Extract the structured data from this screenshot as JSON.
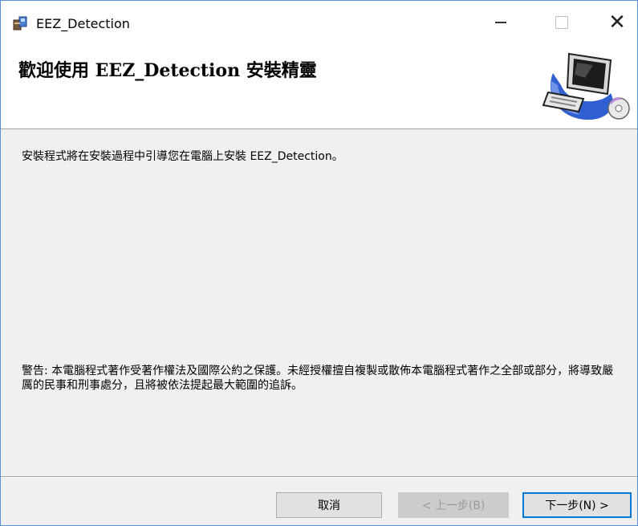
{
  "window": {
    "title": "EEZ_Detection",
    "controls": {
      "minimize": "minimize",
      "maximize": "maximize",
      "close": "close"
    }
  },
  "header": {
    "title": "歡迎使用 EEZ_Detection 安裝精靈"
  },
  "body": {
    "intro": "安裝程式將在安裝過程中引導您在電腦上安裝 EEZ_Detection。",
    "warning": "警告: 本電腦程式著作受著作權法及國際公約之保護。未經授權擅自複製或散佈本電腦程式著作之全部或部分，將導致嚴厲的民事和刑事處分，且將被依法提起最大範圍的追訴。"
  },
  "buttons": {
    "cancel": "取消",
    "back": "< 上一步(B)",
    "next": "下一步(N) >"
  },
  "icons": {
    "app": "installer-icon",
    "header": "computer-setup-icon"
  }
}
